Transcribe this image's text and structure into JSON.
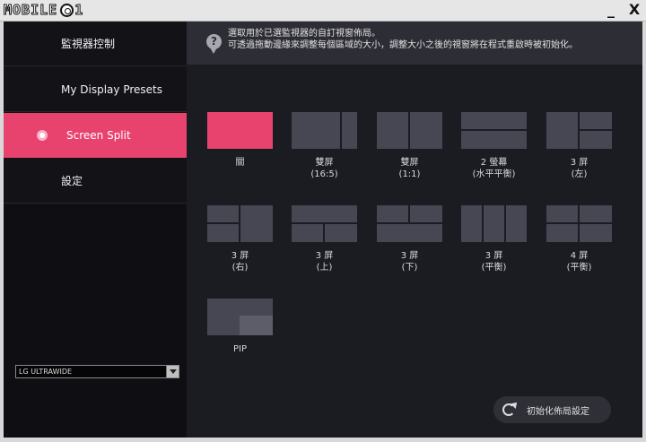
{
  "window": {
    "logo_text": "mobile01",
    "minimize": "_",
    "close": "X"
  },
  "sidebar": {
    "items": [
      {
        "label": "監視器控制",
        "active": false
      },
      {
        "label": "My Display Presets",
        "active": false
      },
      {
        "label": "Screen Split",
        "active": true
      },
      {
        "label": "設定",
        "active": false
      }
    ],
    "monitor_select": {
      "selected": "LG ULTRAWIDE"
    }
  },
  "info": {
    "text": "選取用於已選監視器的自訂視窗佈局。\n可透過拖動邊緣來調整每個區域的大小，調整大小之後的視窗將在程式重啟時被初始化。"
  },
  "layouts": [
    {
      "label": "關",
      "selected": true
    },
    {
      "label": "雙屏\n(16:5)"
    },
    {
      "label": "雙屏\n(1:1)"
    },
    {
      "label": "2 螢幕\n(水平平衡)"
    },
    {
      "label": "3 屏\n(左)"
    },
    {
      "label": "3 屏\n(右)"
    },
    {
      "label": "3 屏\n(上)"
    },
    {
      "label": "3 屏\n(下)"
    },
    {
      "label": "3 屏\n(平衡)"
    },
    {
      "label": "4 屏\n(平衡)"
    },
    {
      "label": "PIP"
    }
  ],
  "reset_button": {
    "label": "初始化佈局設定"
  },
  "colors": {
    "accent": "#e8426f",
    "sidebar": "#121217",
    "main": "#1b1b22",
    "panel": "#474753"
  }
}
